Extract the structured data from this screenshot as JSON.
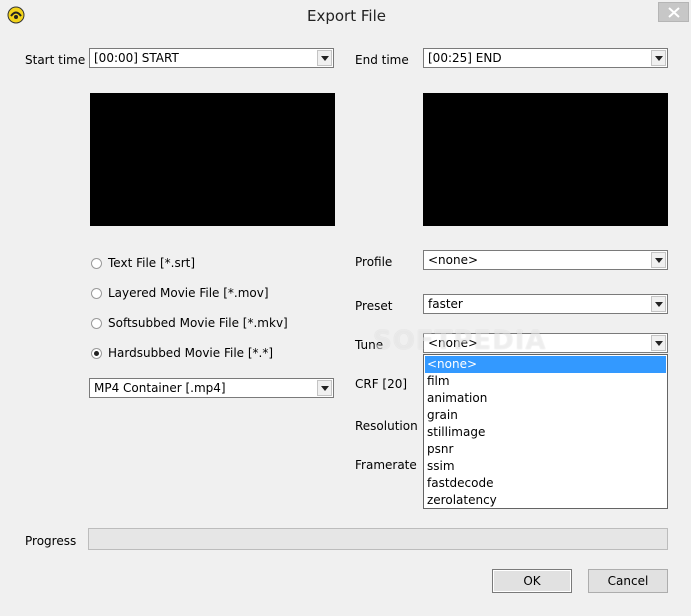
{
  "window": {
    "title": "Export File"
  },
  "start_time": {
    "label": "Start time",
    "value": "[00:00] START"
  },
  "end_time": {
    "label": "End time",
    "value": "[00:25] END"
  },
  "export_types": [
    {
      "label": "Text File [*.srt]",
      "checked": false
    },
    {
      "label": "Layered Movie File [*.mov]",
      "checked": false
    },
    {
      "label": "Softsubbed Movie File [*.mkv]",
      "checked": false
    },
    {
      "label": "Hardsubbed Movie File [*.*]",
      "checked": true
    }
  ],
  "container": {
    "value": "MP4 Container [.mp4]"
  },
  "profile": {
    "label": "Profile",
    "value": "<none>"
  },
  "preset": {
    "label": "Preset",
    "value": "faster"
  },
  "tune": {
    "label": "Tune",
    "value": "<none>",
    "options": [
      "<none>",
      "film",
      "animation",
      "grain",
      "stillimage",
      "psnr",
      "ssim",
      "fastdecode",
      "zerolatency"
    ],
    "selected_index": 0
  },
  "crf": {
    "label": "CRF [20]"
  },
  "resolution": {
    "label": "Resolution"
  },
  "framerate": {
    "label": "Framerate"
  },
  "progress": {
    "label": "Progress",
    "fraction": 0
  },
  "buttons": {
    "ok": "OK",
    "cancel": "Cancel"
  },
  "watermark": "SOFTPEDIA",
  "colors": {
    "selection": "#3399ff",
    "preview_bg": "#000000"
  }
}
